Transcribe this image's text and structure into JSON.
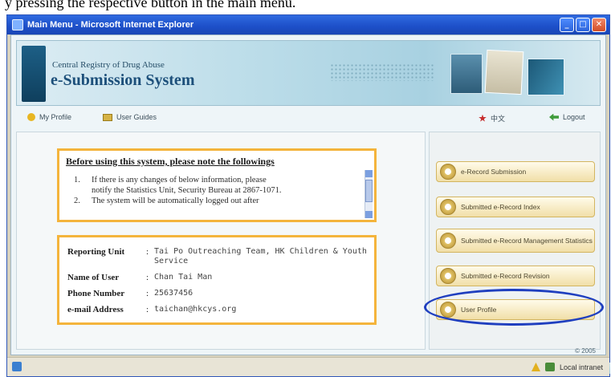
{
  "caption": "y pressing the respective button in the main menu.",
  "window": {
    "title": "Main Menu - Microsoft Internet Explorer",
    "controls": [
      "_",
      "□",
      "✕"
    ]
  },
  "banner": {
    "registry": "Central Registry of Drug Abuse",
    "system_name": "e-Submission System"
  },
  "nav": {
    "my_profile": "My Profile",
    "user_guides": "User Guides",
    "chinese": "中文",
    "logout": "Logout"
  },
  "notice": {
    "title": "Before using this system, please note the followings",
    "items": [
      {
        "num": "1.",
        "line1": "If there is any changes of below information, please",
        "line2": "notify the Statistics Unit, Security Bureau at 2867-1071."
      },
      {
        "num": "2.",
        "line1": "The system will be automatically logged out after",
        "line2": ""
      }
    ]
  },
  "user_info": {
    "reporting_unit_label": "Reporting Unit",
    "reporting_unit_value": "Tai Po Outreaching Team, HK Children & Youth Service",
    "name_label": "Name of User",
    "name_value": "Chan Tai Man",
    "phone_label": "Phone Number",
    "phone_value": "25637456",
    "email_label": "e-mail Address",
    "email_value": "taichan@hkcys.org",
    "separator": ":"
  },
  "menu": {
    "items": [
      {
        "label": "e-Record Submission",
        "icon": "document-icon"
      },
      {
        "label": "Submitted e-Record Index",
        "icon": "index-icon"
      },
      {
        "label": "Submitted e-Record Management Statistics",
        "icon": "statistics-icon"
      },
      {
        "label": "Submitted e-Record Revision",
        "icon": "revision-icon"
      },
      {
        "label": "User Profile",
        "icon": "user-profile-icon"
      }
    ]
  },
  "footer": {
    "copyright": "© 2005"
  },
  "status": {
    "zone": "Local intranet"
  },
  "colors": {
    "accent_border": "#f4b43c",
    "highlight_ellipse": "#1f3fbf",
    "title_bar": "#2f6ae0"
  }
}
